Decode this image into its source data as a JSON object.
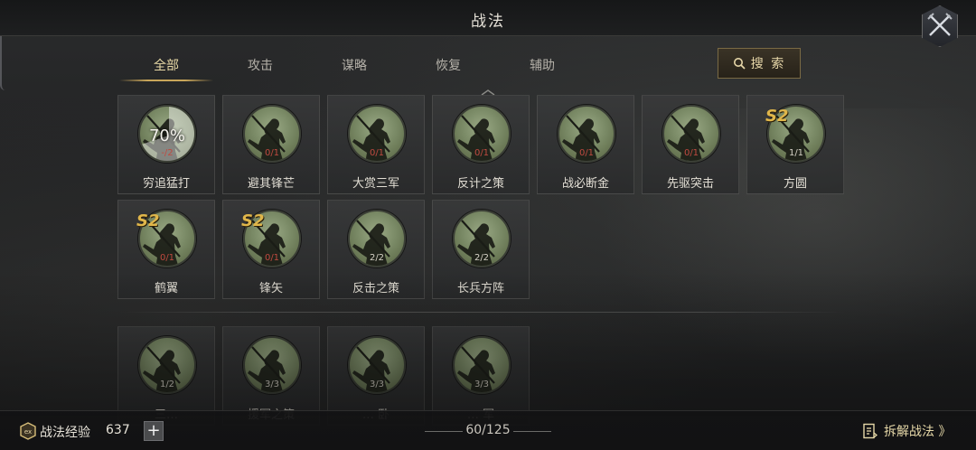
{
  "header": {
    "title": "战法"
  },
  "tabs": [
    {
      "label": "全部",
      "active": true
    },
    {
      "label": "攻击",
      "active": false
    },
    {
      "label": "谋略",
      "active": false
    },
    {
      "label": "恢复",
      "active": false
    },
    {
      "label": "辅助",
      "active": false
    }
  ],
  "search": {
    "label": "搜 索"
  },
  "tactics": [
    {
      "name": "穷追猛打",
      "count": "-/2",
      "progress": "70%",
      "season": ""
    },
    {
      "name": "避其锋芒",
      "count": "0/1",
      "progress": "",
      "season": ""
    },
    {
      "name": "大赏三军",
      "count": "0/1",
      "progress": "",
      "season": ""
    },
    {
      "name": "反计之策",
      "count": "0/1",
      "progress": "",
      "season": ""
    },
    {
      "name": "战必断金",
      "count": "0/1",
      "progress": "",
      "season": ""
    },
    {
      "name": "先驱突击",
      "count": "0/1",
      "progress": "",
      "season": ""
    },
    {
      "name": "方圆",
      "count": "1/1",
      "progress": "",
      "season": "S2"
    },
    {
      "name": "鹤翼",
      "count": "0/1",
      "progress": "",
      "season": "S2"
    },
    {
      "name": "锋矢",
      "count": "0/1",
      "progress": "",
      "season": "S2"
    },
    {
      "name": "反击之策",
      "count": "2/2",
      "progress": "",
      "season": ""
    },
    {
      "name": "长兵方阵",
      "count": "2/2",
      "progress": "",
      "season": ""
    }
  ],
  "tactics_lower": [
    {
      "name": "三… ",
      "count": "1/2"
    },
    {
      "name": "援军之策",
      "count": "3/3"
    },
    {
      "name": "… 卧",
      "count": "3/3"
    },
    {
      "name": "… 军",
      "count": "3/3"
    }
  ],
  "footer": {
    "exp_label": "战法经验",
    "exp_value": "637",
    "add_symbol": "+",
    "page_count": "60/125",
    "disassemble_label": "拆解战法 》"
  },
  "colors": {
    "accent_gold": "#c9a65a",
    "count_unowned": "#c04a40",
    "season_gold": "#e0b64a"
  }
}
